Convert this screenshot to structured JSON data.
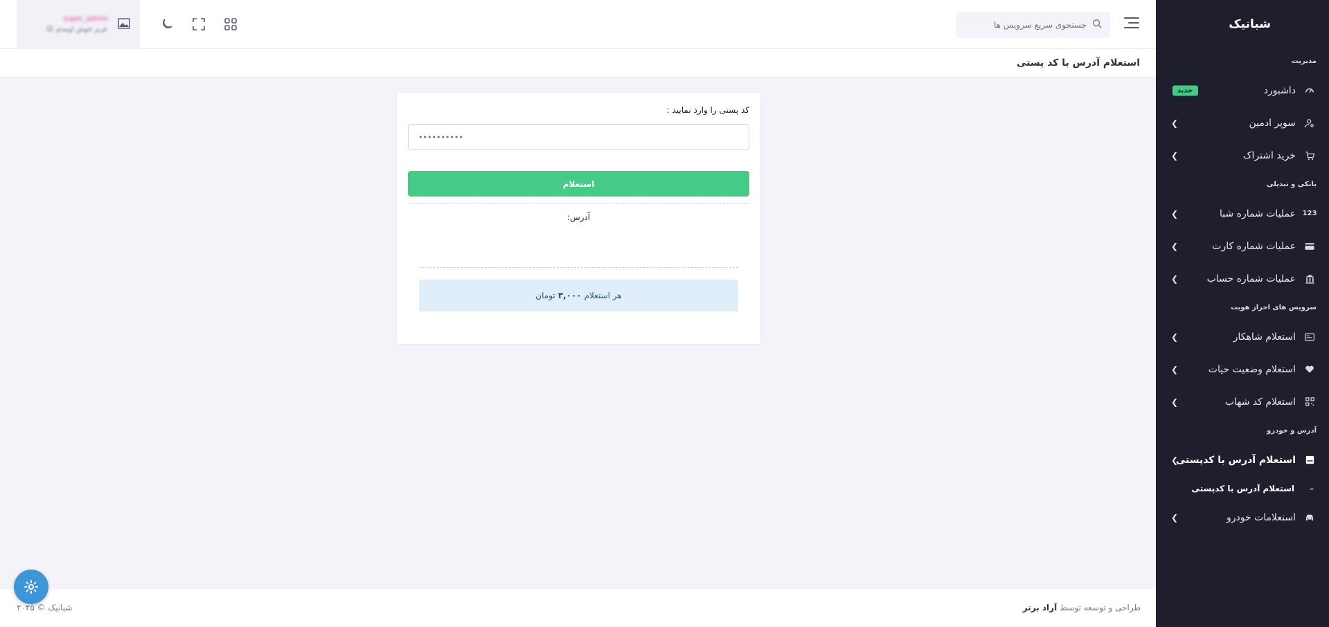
{
  "brand": {
    "logo_text": "شبانیک"
  },
  "sidebar": {
    "sections": [
      {
        "title": "مدیریت",
        "items": [
          {
            "label": "داشبورد",
            "icon": "speedometer-icon",
            "badge": "جدید"
          },
          {
            "label": "سوپر ادمین",
            "icon": "user-cog-icon"
          },
          {
            "label": "خرید اشتراک",
            "icon": "cart-icon"
          }
        ]
      },
      {
        "title": "بانکی و تبدیلی",
        "items": [
          {
            "label": "عملیات شماره شبا",
            "icon": "numbers-icon"
          },
          {
            "label": "عملیات شماره کارت",
            "icon": "card-icon"
          },
          {
            "label": "عملیات شماره حساب",
            "icon": "bank-icon"
          }
        ]
      },
      {
        "title": "سرویس های احراز هویت",
        "items": [
          {
            "label": "استعلام شاهکار",
            "icon": "id-card-icon"
          },
          {
            "label": "استعلام وضعیت حیات",
            "icon": "heart-icon"
          },
          {
            "label": "استعلام کد شهاب",
            "icon": "qr-icon"
          }
        ]
      },
      {
        "title": "آدرس و خودرو",
        "items": [
          {
            "label": "استعلام آدرس با کدپستی",
            "icon": "mailbox-icon",
            "active": true,
            "sub": "استعلام آدرس با کدپستی"
          },
          {
            "label": "استعلامات خودرو",
            "icon": "car-icon"
          }
        ]
      }
    ]
  },
  "header": {
    "search_placeholder": "جستجوی سریع سرویس ها",
    "user_name": "super_admin",
    "welcome": "عزیز خوش اومدی"
  },
  "page": {
    "title": "استعلام آدرس با کد پستی"
  },
  "form": {
    "label": "کد پستی را وارد نمایید :",
    "placeholder": "••••••••••",
    "submit_label": "استعلام",
    "address_label": "آدرس:",
    "price_prefix": "هر استعلام",
    "price_value": "۳,۰۰۰",
    "price_unit": "تومان"
  },
  "footer": {
    "credit_prefix": "طراحی و توسعه توسط",
    "credit_name": "آراد برتر",
    "copyright": "شبانیک © ۲۰۲۵"
  },
  "colors": {
    "primary_green": "#45cb85",
    "sidebar_bg": "#1e1e2d",
    "fab_blue": "#3f95d6"
  }
}
